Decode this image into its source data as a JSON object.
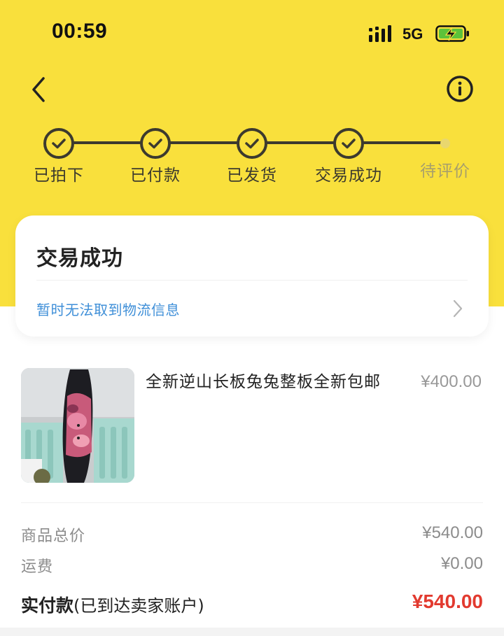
{
  "status_bar": {
    "time": "00:59",
    "network": "5G"
  },
  "nav": {
    "back_icon": "chevron-left-icon",
    "info_icon": "info-circle-icon"
  },
  "progress": {
    "steps": [
      {
        "label": "已拍下",
        "done": true
      },
      {
        "label": "已付款",
        "done": true
      },
      {
        "label": "已发货",
        "done": true
      },
      {
        "label": "交易成功",
        "done": true
      },
      {
        "label": "待评价",
        "done": false
      }
    ]
  },
  "status_card": {
    "title": "交易成功",
    "logistics_text": "暂时无法取到物流信息"
  },
  "product": {
    "title": "全新逆山长板兔兔整板全新包邮",
    "price": "¥400.00"
  },
  "summary": {
    "goods_total_label": "商品总价",
    "goods_total_value": "¥540.00",
    "shipping_label": "运费",
    "shipping_value": "¥0.00",
    "paid_label_main": "实付款",
    "paid_label_note": "(已到达卖家账户)",
    "paid_value": "¥540.00"
  },
  "colors": {
    "header_yellow": "#f9e03c",
    "link_blue": "#3f8fd8",
    "price_red": "#e23a2f"
  }
}
